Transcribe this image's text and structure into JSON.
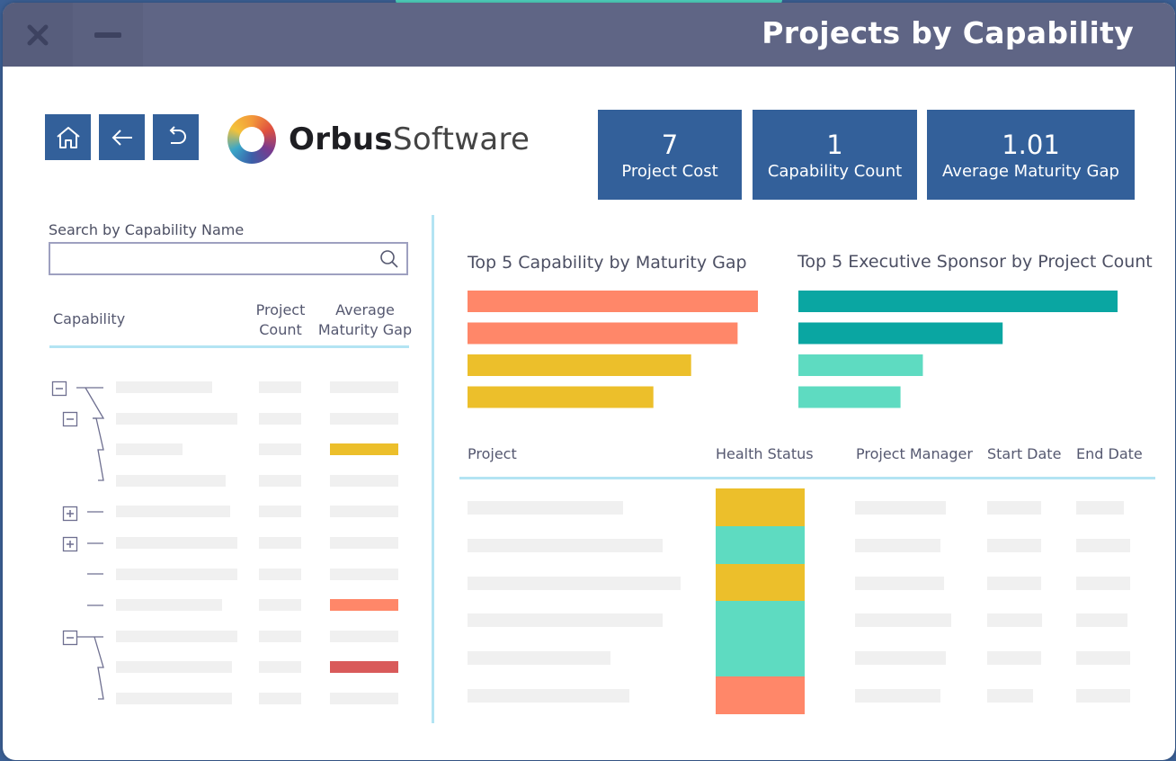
{
  "window": {
    "title": "Projects by Capability"
  },
  "titlebar": {
    "close_icon": "close-icon",
    "minimize_icon": "minimize-icon"
  },
  "nav": {
    "home_icon": "home-icon",
    "back_icon": "arrow-left-icon",
    "undo_icon": "undo-icon"
  },
  "logo": {
    "bold": "Orbus",
    "light": "Software"
  },
  "kpis": [
    {
      "value": "7",
      "label": "Project Cost"
    },
    {
      "value": "1",
      "label": "Capability Count"
    },
    {
      "value": "1.01",
      "label": "Average Maturity Gap"
    }
  ],
  "search": {
    "label": "Search by Capability Name",
    "value": "",
    "placeholder": ""
  },
  "capability_table": {
    "headers": {
      "name": "Capability",
      "count_1": "Project",
      "count_2": "Count",
      "gap_1": "Average",
      "gap_2": "Maturity Gap"
    },
    "gap_colors": [
      "#ecbf2b",
      "#ff8769",
      "#d95a5a"
    ]
  },
  "charts": {
    "maturity_gap_title": "Top 5 Capability by Maturity Gap",
    "sponsor_title": "Top 5 Executive Sponsor by Project Count"
  },
  "chart_data": [
    {
      "type": "bar",
      "orientation": "horizontal",
      "title": "Top 5 Capability by Maturity Gap",
      "categories": [
        "",
        "",
        "",
        ""
      ],
      "values": [
        1.0,
        0.93,
        0.77,
        0.64
      ],
      "colors": [
        "#ff8769",
        "#ff8769",
        "#ecbf2b",
        "#ecbf2b"
      ]
    },
    {
      "type": "bar",
      "orientation": "horizontal",
      "title": "Top 5 Executive Sponsor by Project Count",
      "categories": [
        "",
        "",
        "",
        ""
      ],
      "values": [
        1.0,
        0.64,
        0.39,
        0.32
      ],
      "colors": [
        "#0aa6a2",
        "#0aa6a2",
        "#5edbc1",
        "#5edbc1"
      ]
    }
  ],
  "projects_table": {
    "headers": [
      "Project",
      "Health Status",
      "Project Manager",
      "Start Date",
      "End Date"
    ],
    "health_colors": [
      "#ecbf2b",
      "#5edbc1",
      "#ecbf2b",
      "#5edbc1",
      "#5edbc1",
      "#ff8769"
    ]
  }
}
